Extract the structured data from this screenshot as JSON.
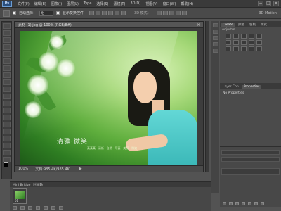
{
  "app": {
    "logo": "Ps",
    "menu": [
      "文件(F)",
      "编辑(E)",
      "图像(I)",
      "图层(L)",
      "Type",
      "选择(S)",
      "滤镜(T)",
      "3D(D)",
      "视图(V)",
      "窗口(W)",
      "帮助(H)"
    ],
    "workspace_label": "3D Motion"
  },
  "options": {
    "auto_select_label": "自动选择：",
    "auto_select_value": "组",
    "transform_label": "显示变换控件",
    "mode_label": "3D 模式："
  },
  "document": {
    "tab_title": "素材 (1).jpg @ 100% (RGB/8#)",
    "close_glyph": "×",
    "canvas_title": "清雅·微笑",
    "canvas_subtitle": "某某某 · 清新 · 自然 · 写真 · 美丽 · 微笑",
    "status_zoom": "100%",
    "status_doc": "文档:985.4K/985.4K",
    "status_arrow": "▶"
  },
  "panels": {
    "top_tabs": [
      "Create",
      "颜色",
      "色板",
      "样式"
    ],
    "adjustments_label": "Adjustm...",
    "prop_tabs": [
      "Layer Con",
      "Properties"
    ],
    "no_properties": "No Properties"
  },
  "bottom": {
    "tabs": [
      "Mini Bridge",
      "时间轴"
    ],
    "thumb_caption": "01"
  }
}
